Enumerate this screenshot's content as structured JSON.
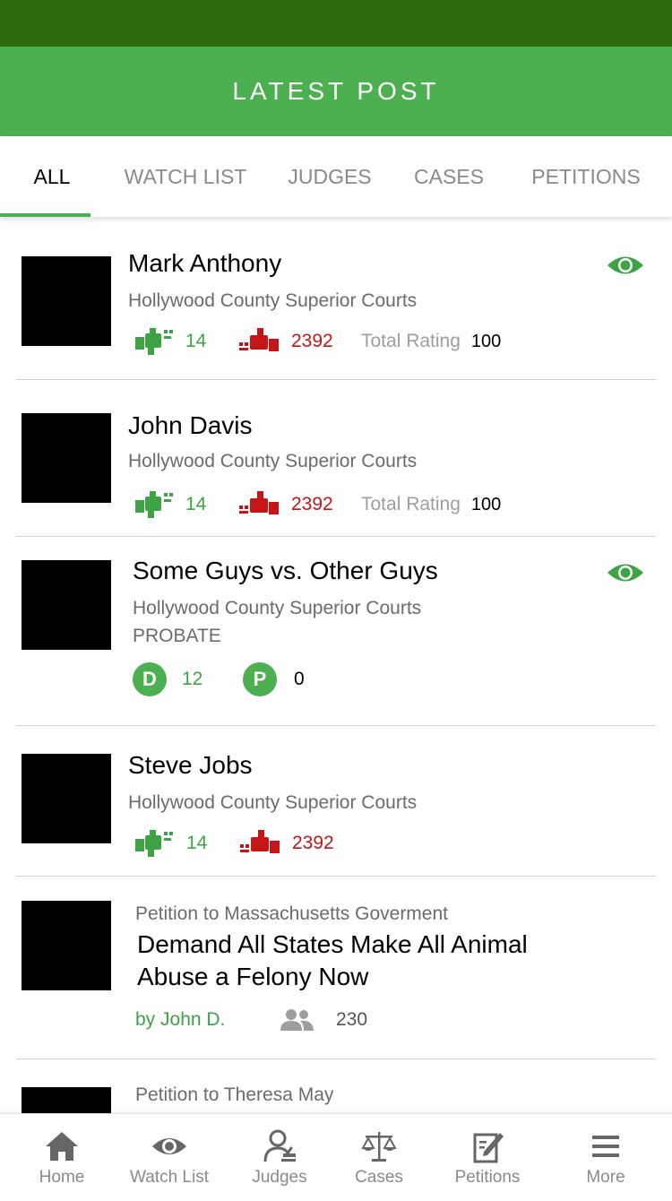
{
  "header": {
    "title": "LATEST POST"
  },
  "tabs": [
    {
      "label": "ALL",
      "active": true
    },
    {
      "label": "WATCH LIST",
      "active": false
    },
    {
      "label": "JUDGES",
      "active": false
    },
    {
      "label": "CASES",
      "active": false
    },
    {
      "label": "PETITIONS",
      "active": false
    }
  ],
  "colors": {
    "status_bar": "#2e6b10",
    "header": "#4caf50",
    "positive": "#3da345",
    "negative": "#c41616"
  },
  "feed": {
    "item1": {
      "name": "Mark Anthony",
      "court": "Hollywood County Superior Courts",
      "up": "14",
      "down": "2392",
      "rating_label": "Total Rating",
      "rating": "100",
      "watched": true
    },
    "item2": {
      "name": "John Davis",
      "court": "Hollywood County Superior Courts",
      "up": "14",
      "down": "2392",
      "rating_label": "Total Rating",
      "rating": "100",
      "watched": false
    },
    "item3": {
      "name": "Some Guys vs. Other Guys",
      "court": "Hollywood County Superior Courts",
      "category": "PROBATE",
      "d_badge": "D",
      "d_count": "12",
      "p_badge": "P",
      "p_count": "0",
      "watched": true
    },
    "item4": {
      "name": "Steve Jobs",
      "court": "Hollywood County Superior Courts",
      "up": "14",
      "down": "2392"
    },
    "item5": {
      "target": "Petition to Massachusetts Goverment",
      "title_line1": "Demand All States Make All Animal",
      "title_line2": "Abuse a Felony Now",
      "author": "by John D.",
      "supporters": "230"
    },
    "item6": {
      "target": "Petition to Theresa May"
    }
  },
  "icons": {
    "thumbs_up": "thumbs-up-icon",
    "thumbs_down": "thumbs-down-icon",
    "watch": "eye-icon",
    "supporters": "people-icon"
  },
  "bottom_nav": [
    {
      "label": "Home",
      "icon": "home-icon"
    },
    {
      "label": "Watch List",
      "icon": "eye-icon"
    },
    {
      "label": "Judges",
      "icon": "judge-icon"
    },
    {
      "label": "Cases",
      "icon": "scales-icon"
    },
    {
      "label": "Petitions",
      "icon": "petition-icon"
    },
    {
      "label": "More",
      "icon": "menu-icon"
    }
  ]
}
